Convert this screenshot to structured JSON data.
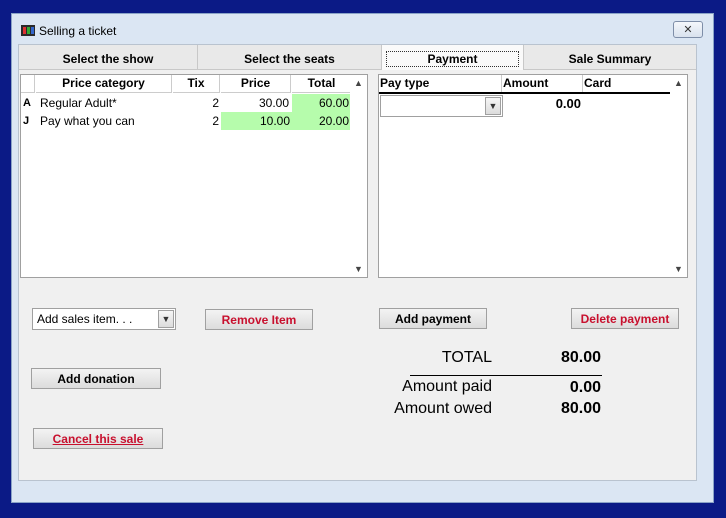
{
  "window": {
    "title": "Selling a ticket",
    "close_glyph": "✕"
  },
  "tabs": [
    {
      "label": "Select the show"
    },
    {
      "label": "Select the seats"
    },
    {
      "label": "Payment",
      "active": true
    },
    {
      "label": "Sale Summary"
    }
  ],
  "price_table": {
    "headers": {
      "category": "Price category",
      "tix": "Tix",
      "price": "Price",
      "total": "Total"
    },
    "rows": [
      {
        "code": "A",
        "category": "Regular Adult*",
        "tix": "2",
        "price": "30.00",
        "total": "60.00"
      },
      {
        "code": "J",
        "category": "Pay what you can",
        "tix": "2",
        "price": "10.00",
        "total": "20.00"
      }
    ]
  },
  "payment_table": {
    "headers": {
      "pay_type": "Pay type",
      "amount": "Amount",
      "card": "Card"
    },
    "rows": [
      {
        "pay_type": "",
        "amount": "0.00",
        "card": ""
      }
    ]
  },
  "controls": {
    "add_sales_item": "Add sales item. . .",
    "remove_item": "Remove Item",
    "add_payment": "Add payment",
    "delete_payment": "Delete payment",
    "add_donation": "Add donation",
    "cancel_sale": "Cancel this sale"
  },
  "totals": {
    "total_label": "TOTAL",
    "total_value": "80.00",
    "paid_label": "Amount paid",
    "paid_value": "0.00",
    "owed_label": "Amount owed",
    "owed_value": "80.00"
  },
  "colors": {
    "highlight_green": "#b6fcac",
    "accent_red": "#c8102e",
    "desktop_blue": "#0b1a86"
  },
  "icons": {
    "app": "ticket-app-icon",
    "close": "close-icon",
    "scroll_up": "scroll-up-icon",
    "scroll_down": "scroll-down-icon",
    "dropdown": "chevron-down-icon"
  }
}
